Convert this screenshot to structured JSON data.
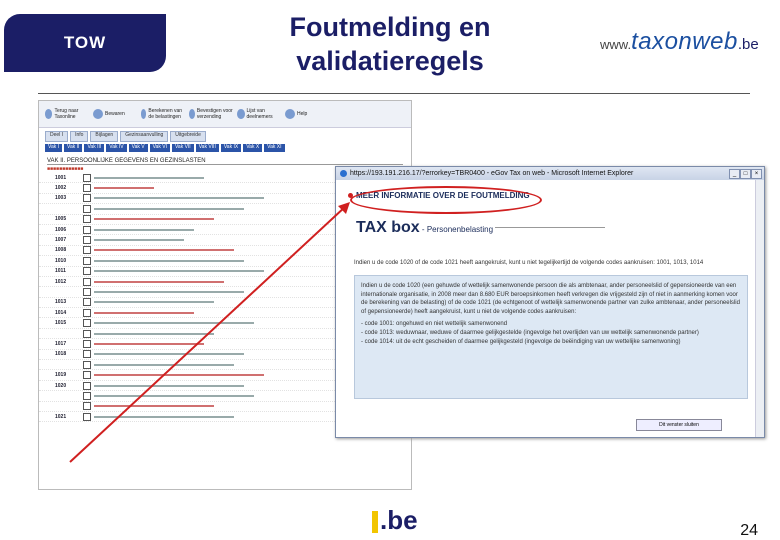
{
  "header": {
    "badge": "TOW",
    "title_line1": "Foutmelding en",
    "title_line2": "validatieregels",
    "logo_prefix": "www.",
    "logo_main": "taxonweb",
    "logo_suffix": ".be"
  },
  "footer": {
    "logo_text": ".be",
    "page_number": "24"
  },
  "screenshot": {
    "toolbar": [
      "Terug naar Taxonline",
      "Bewaren",
      "Berekenen van de belastingen",
      "Bevestigen voor verzending",
      "Lijst van deelnemers",
      "Help"
    ],
    "tabs": [
      "Deel I",
      "Info",
      "Bijlagen",
      "Gezinsaanvulling",
      "Uitgebreide"
    ],
    "subtabs": [
      "Vak I",
      "Vak II",
      "Vak III",
      "Vak IV",
      "Vak V",
      "Vak VI",
      "Vak VII",
      "Vak VIII",
      "Vak IX",
      "Vak X",
      "Vak XI"
    ],
    "section_title": "VAK II. PERSOONLIJKE GEGEVENS EN GEZINSLASTEN",
    "codes": [
      "1001",
      "1002",
      "1003",
      "",
      "1005",
      "1006",
      "1007",
      "1008",
      "1010",
      "1011",
      "1012",
      "",
      "1013",
      "1014",
      "1015",
      "",
      "1017",
      "1018",
      "",
      "1019",
      "1020",
      "",
      "",
      "1021"
    ]
  },
  "popup": {
    "window_title": "https://193.191.216.17/?errorkey=TBR0400 - eGov Tax on web - Microsoft Internet Explorer",
    "heading": "MEER INFORMATIE OVER DE FOUTMELDING",
    "taxbox_main": "TAX box",
    "taxbox_sub": "Personenbelasting",
    "intro": "Indien u de code 1020 of de code 1021 heeft aangekruist, kunt u niet tegelijkertijd de volgende codes aankruisen: 1001, 1013, 1014",
    "info_paragraph": "Indien u de code 1020 (een gehuwde of wettelijk samenwonende persoon die als ambtenaar, ander personeelslid of gepensioneerde van een internationale organisatie, in 2008 meer dan 8.680 EUR beroepsinkomen heeft verkregen die vrijgesteld zijn of niet in aanmerking komen voor de berekening van de belasting) of de code 1021 (de echtgenoot of wettelijk samenwonende partner van zulke ambtenaar, ander personeelslid of gepensioneerde) heeft aangekruist, kunt u niet de volgende codes aankruisen:",
    "codes": [
      "- code 1001: ongehuwd en niet wettelijk samenwonend",
      "- code 1013: weduwnaar, weduwe of daarmee gelijkgestelde (ingevolge het overlijden van uw wettelijk samenwonende partner)",
      "- code 1014: uit de echt gescheiden of daarmee gelijkgesteld (ingevolge de beëindiging van uw wettelijke samenwoning)"
    ],
    "close_label": "Dit venster sluiten"
  },
  "colors": {
    "navy": "#1b1e66",
    "highlight": "#d02020"
  }
}
